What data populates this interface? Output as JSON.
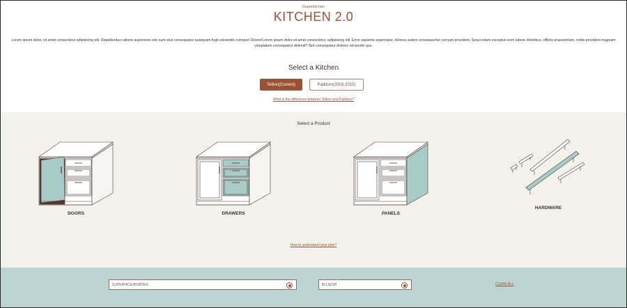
{
  "header": {
    "brand": "Superkitchen",
    "title": "KITCHEN 2.0",
    "description": "Lorem ipsum dolor, sit amet consectetur adipisicing elit. Repellendus ratione asperiores iste sunt eius consequatur quisquam fugit reiciendis cumque! Dolore!Lorem ipsum dolor sit amet consectetur, adipisicing elit. Error sapiente aspernatur, dolores autem consequuntur corrupti provident. Sequi totam excepturi eum labore doloribus, officiis praesentium, nobis provident magnam voluptatum consequatur deleniti? Sint consequatur dolores reiciendis quo."
  },
  "kitchen_select": {
    "title": "Select a Kitchen",
    "options": [
      {
        "label": "Tellion(Current)",
        "selected": true
      },
      {
        "label": "Paddum(2003-2015)",
        "selected": false
      }
    ],
    "difference_link": "What is the difference between Tellion and Paddum?"
  },
  "product_select": {
    "title": "Select a Product",
    "products": [
      {
        "label": "DOORS",
        "icon": "cabinet-doors-icon"
      },
      {
        "label": "DRAWERS",
        "icon": "cabinet-drawers-icon"
      },
      {
        "label": "PANELS",
        "icon": "cabinet-panels-icon"
      },
      {
        "label": "HARDWARE",
        "icon": "handles-hardware-icon"
      }
    ],
    "plan_link": "How to understand your plan?"
  },
  "filters": {
    "items": [
      {
        "label": "SUPERNICE/BORDER"
      },
      {
        "label": "BLUEISH"
      }
    ],
    "clear_label": "CLEAR ALL"
  },
  "colors": {
    "accent": "#9a5236",
    "highlight": "#b7d3cf",
    "product_bg": "#f2f1ec",
    "filter_bg": "#bcd5d2"
  }
}
